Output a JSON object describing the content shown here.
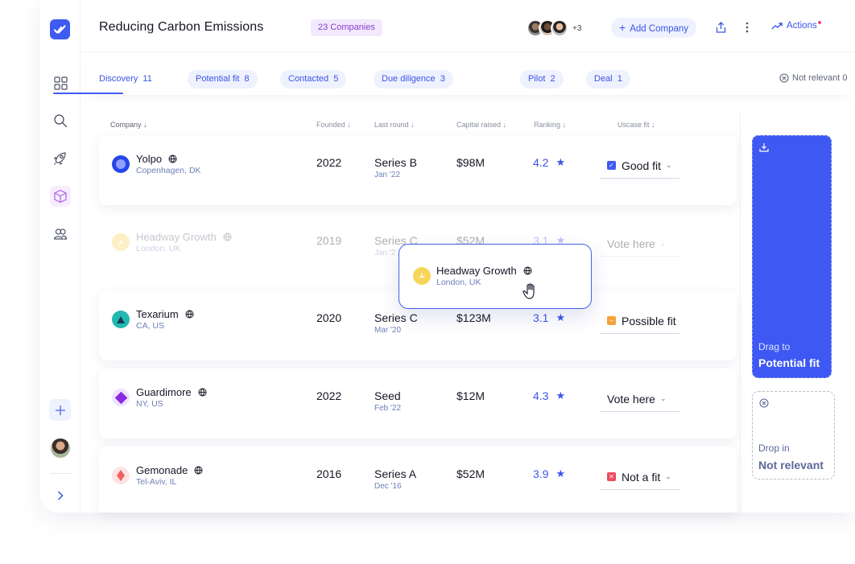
{
  "header": {
    "title": "Reducing Carbon Emissions",
    "count_badge": "23 Companies",
    "extra_members": "+3",
    "add_company": "Add Company",
    "actions": "Actions"
  },
  "tabs": [
    {
      "label": "Discovery",
      "count": "11"
    },
    {
      "label": "Potential fit",
      "count": "8"
    },
    {
      "label": "Contacted",
      "count": "5"
    },
    {
      "label": "Due diligence",
      "count": "3"
    },
    {
      "label": "Pilot",
      "count": "2"
    },
    {
      "label": "Deal",
      "count": "1"
    }
  ],
  "not_relevant_tab": {
    "label": "Not relevant",
    "count": "0"
  },
  "columns": {
    "company": "Company",
    "founded": "Founded",
    "last_round": "Last round",
    "capital": "Capital raised",
    "ranking": "Ranking",
    "usecase": "Uscase fit"
  },
  "rows": [
    {
      "name": "Yolpo",
      "location": "Copenhagen, DK",
      "founded": "2022",
      "round": "Series B",
      "round_date": "Jan '22",
      "capital": "$98M",
      "ranking": "4.2",
      "fit": "Good fit",
      "fit_color": "#3e5bf2"
    },
    {
      "name": "Headway Growth",
      "location": "London, UK",
      "founded": "2019",
      "round": "Series C",
      "round_date": "Jan '2",
      "capital": "$52M",
      "ranking": "3.1",
      "fit": "Vote here",
      "fit_color": ""
    },
    {
      "name": "Texarium",
      "location": "CA, US",
      "founded": "2020",
      "round": "Series C",
      "round_date": "Mar '20",
      "capital": "$123M",
      "ranking": "3.1",
      "fit": "Possible fit",
      "fit_color": "#f5a13c"
    },
    {
      "name": "Guardimore",
      "location": "NY, US",
      "founded": "2022",
      "round": "Seed",
      "round_date": "Feb '22",
      "capital": "$12M",
      "ranking": "4.3",
      "fit": "Vote here",
      "fit_color": ""
    },
    {
      "name": "Gemonade",
      "location": "Tel-Aviv, IL",
      "founded": "2016",
      "round": "Series A",
      "round_date": "Dec '16",
      "capital": "$52M",
      "ranking": "3.9",
      "fit": "Not a fit",
      "fit_color": "#ef4a5e"
    }
  ],
  "drag_card": {
    "name": "Headway Growth",
    "location": "London, UK"
  },
  "drop_potential": {
    "label": "Drag to",
    "target": "Potential fit"
  },
  "drop_not_relevant": {
    "label": "Drop in",
    "target": "Not relevant"
  },
  "colors": {
    "accent": "#3e5bf2",
    "badge_bg": "#f2e9fd",
    "badge_text": "#8a3fcf"
  },
  "icons": [
    "logo-check-icon",
    "grid-icon",
    "search-icon",
    "rocket-icon",
    "cube-icon",
    "users-icon",
    "plus-icon",
    "chevron-right-icon",
    "share-icon",
    "more-vertical-icon",
    "trend-icon",
    "globe-icon",
    "star-icon",
    "download-icon",
    "close-circle-icon",
    "hand-cursor-icon"
  ]
}
